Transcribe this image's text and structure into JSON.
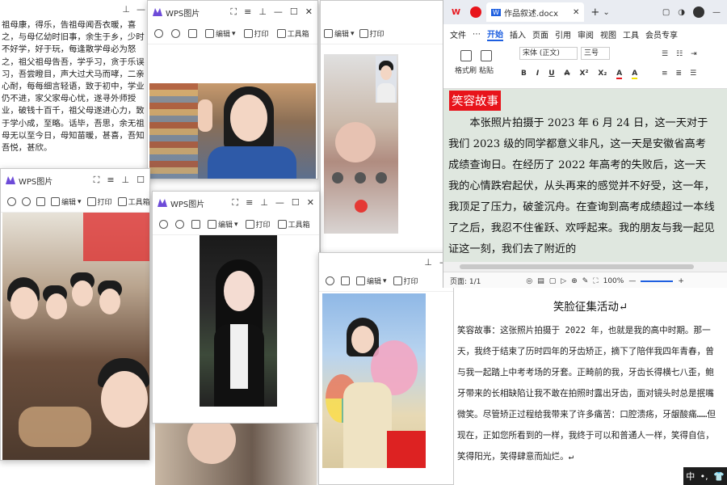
{
  "bgdoc": {
    "text": "祖母康，得乐，告祖母闻吾衣暖，喜之，与母亿幼时旧事，余生于乡，少时不好学，好于玩，每逢散学母必为怒之，祖父祖母告吾，学乎习，贪于乐误习，吾尝瞪目，声大过犬马而哮，二亲心耐，每每细言轻语，致于初中，学业仍不进，家父家母心忧，遂寻外师授业，破钱十百千，祖父母遂进心力，致于学小成，至略。话毕，吾思，余无祖母无以至今日，母知苗暖，甚喜，吾知吾悦，甚欣。"
  },
  "win1": {
    "title": "WPS图片",
    "tools": [
      "编辑",
      "打印",
      "工具箱"
    ]
  },
  "win2": {
    "title": "WPS图片",
    "tools": [
      "编辑",
      "打印",
      "工具箱"
    ]
  },
  "win3": {
    "title": "WPS图片",
    "tools": [
      "编辑",
      "打印",
      "工具箱"
    ]
  },
  "win4": {
    "tools": [
      "编辑",
      "打印"
    ]
  },
  "win5": {
    "tools": [
      "编辑",
      "打印",
      "工具箱"
    ]
  },
  "writer": {
    "app_tab": "W",
    "doc_tab": "作品叙述.docx",
    "menu": [
      "文件",
      "⋯",
      "开始",
      "插入",
      "页面",
      "引用",
      "审阅",
      "视图",
      "工具",
      "会员专享"
    ],
    "active_menu": "开始",
    "format_brush": "格式刷",
    "paste": "粘贴",
    "font": "宋体 (正文)",
    "size": "三号",
    "heading": "笑容故事",
    "paragraph": "本张照片拍摄于 2023 年 6 月 24 日，这一天对于我们 2023 级的同学都意义非凡，这一天是安徽省高考成绩查询日。在经历了 2022 年高考的失败后，这一天我的心情跌宕起伏，从头再来的感觉并不好受，这一年，我顶足了压力，破釜沉舟。在查询到高考成绩超过一本线了之后，我忍不住雀跃、欢呼起来。我的朋友与我一起见证这一刻，我们去了附近的",
    "page_info": "页面: 1/1",
    "zoom": "100%"
  },
  "doc2": {
    "title": "笑脸征集活动↵",
    "body": "笑容故事：这张照片拍摄于 2022 年，也就是我的高中时期。那一天，我终于结束了历时四年的牙齿矫正，摘下了陪伴我四年青春，曾与我一起踏上中考考场的牙套。正畸前的我，牙齿长得横七八歪，鲍牙带来的长相缺陷让我不敢在拍照时露出牙齿，面对镜头时总是抿嘴微笑。尽管矫正过程给我带来了许多痛苦：口腔溃疡，牙龈酸痛……但现在，正如您所看到的一样，我终于可以和普通人一样，笑得自信，笑得阳光，笑得肆意而灿烂。↵"
  },
  "tray": {
    "ime": "中",
    "punct": "•,"
  },
  "colors": {
    "wps_blue": "#1e5fe0",
    "heading_red": "#e8141b",
    "page_green": "#dfe7df"
  }
}
